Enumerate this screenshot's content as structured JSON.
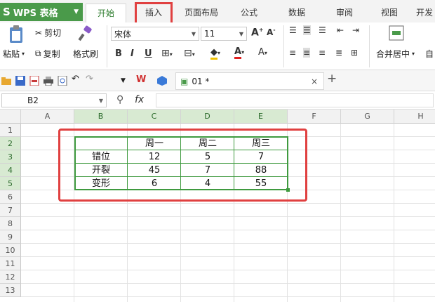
{
  "app": {
    "name": "WPS 表格",
    "logo": "S"
  },
  "tabs": [
    {
      "label": "开始",
      "active": true
    },
    {
      "label": "插入",
      "active": false
    },
    {
      "label": "页面布局",
      "active": false
    },
    {
      "label": "公式",
      "active": false
    },
    {
      "label": "数据",
      "active": false
    },
    {
      "label": "审阅",
      "active": false
    },
    {
      "label": "视图",
      "active": false
    },
    {
      "label": "开发",
      "active": false
    }
  ],
  "ribbon": {
    "paste": "粘贴",
    "cut": "剪切",
    "copy": "复制",
    "format_painter": "格式刷",
    "font_name": "宋体",
    "font_size": "11",
    "bold": "B",
    "italic": "I",
    "underline": "U",
    "merge_center": "合并居中",
    "auto": "自"
  },
  "document_tab": {
    "title": "01 *"
  },
  "formula_bar": {
    "cell_ref": "B2",
    "fx": "fx",
    "value": ""
  },
  "columns": [
    "A",
    "B",
    "C",
    "D",
    "E",
    "F",
    "G",
    "H"
  ],
  "selected_columns": [
    "B",
    "C",
    "D",
    "E"
  ],
  "rows": [
    "1",
    "2",
    "3",
    "4",
    "5",
    "6",
    "7",
    "8",
    "9",
    "10",
    "11",
    "12",
    "13"
  ],
  "selected_rows": [
    "2",
    "3",
    "4",
    "5"
  ],
  "table": {
    "header": [
      "",
      "周一",
      "周二",
      "周三"
    ],
    "rows": [
      [
        "错位",
        "12",
        "5",
        "7"
      ],
      [
        "开裂",
        "45",
        "7",
        "88"
      ],
      [
        "变形",
        "6",
        "4",
        "55"
      ]
    ]
  },
  "colors": {
    "brand": "#4a9a4a",
    "highlight": "#e04040",
    "selection": "#3f9a3f"
  }
}
